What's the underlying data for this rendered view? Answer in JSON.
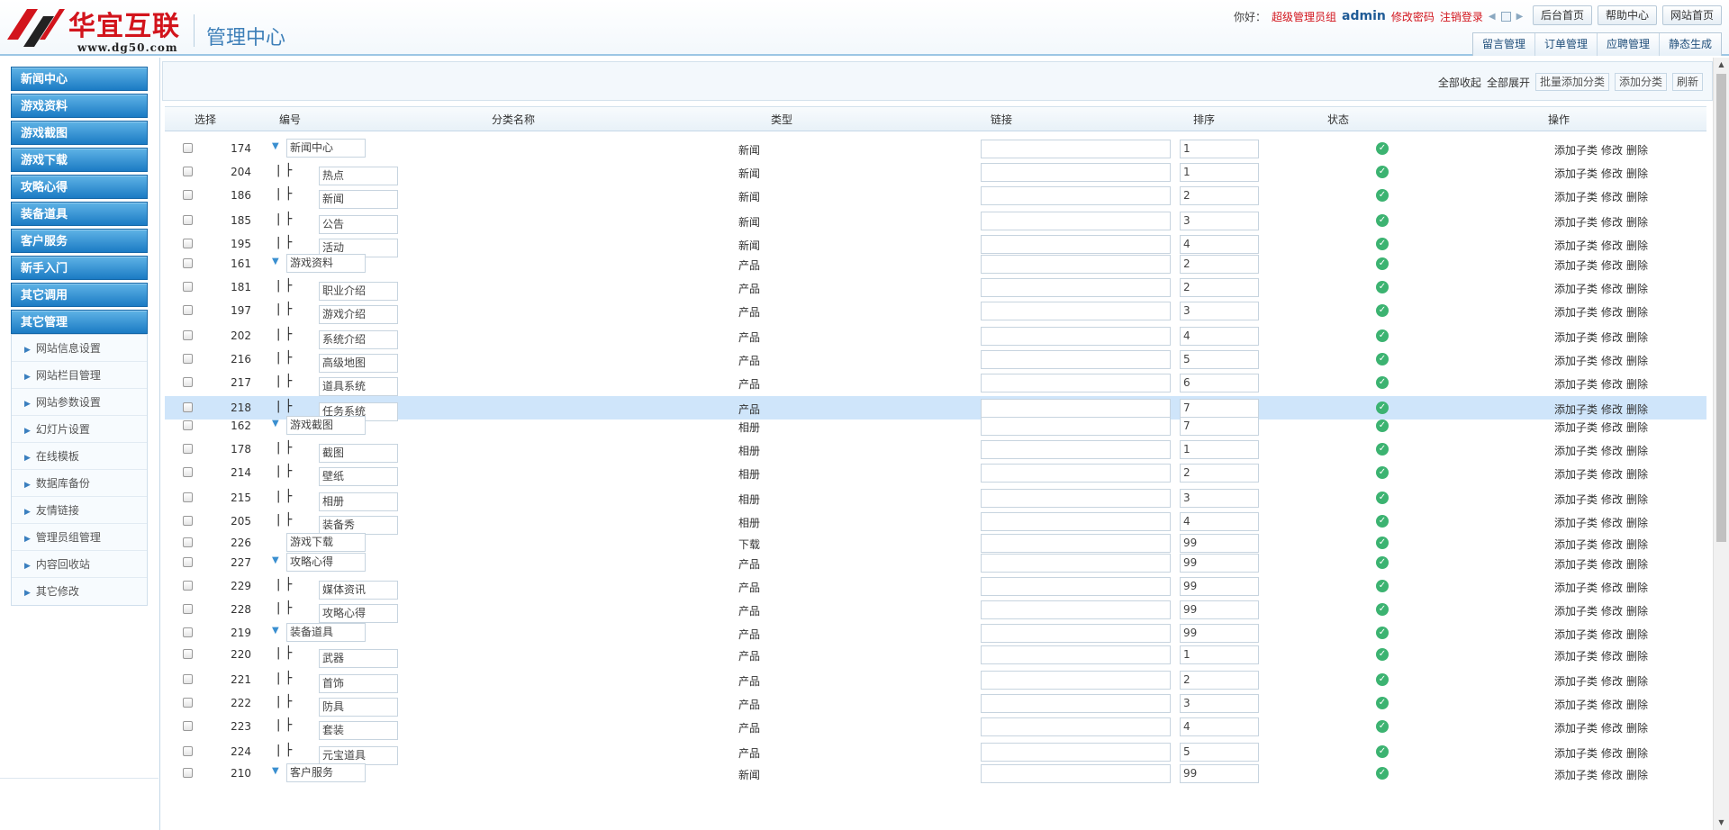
{
  "header": {
    "logo_cn": "华宜互联",
    "logo_url": "www.dg50.com",
    "title": "管理中心",
    "greeting": "你好：",
    "role": "超级管理员组",
    "username": "admin",
    "change_password": "修改密码",
    "logout": "注销登录",
    "top_buttons": [
      "后台首页",
      "帮助中心",
      "网站首页"
    ],
    "nav_tabs": [
      "留言管理",
      "订单管理",
      "应聘管理",
      "静态生成"
    ]
  },
  "sidebar": {
    "categories": [
      "新闻中心",
      "游戏资料",
      "游戏截图",
      "游戏下载",
      "攻略心得",
      "装备道具",
      "客户服务",
      "新手入门",
      "其它调用",
      "其它管理"
    ],
    "subitems": [
      "网站信息设置",
      "网站栏目管理",
      "网站参数设置",
      "幻灯片设置",
      "在线模板",
      "数据库备份",
      "友情链接",
      "管理员组管理",
      "内容回收站",
      "其它修改"
    ]
  },
  "toolbar": {
    "collapse_all": "全部收起",
    "expand_all": "全部展开",
    "batch_add": "批量添加分类",
    "add_category": "添加分类",
    "refresh": "刷新"
  },
  "table": {
    "headers": {
      "select": "选择",
      "id": "编号",
      "name": "分类名称",
      "type": "类型",
      "link": "链接",
      "sort": "排序",
      "status": "状态",
      "ops": "操作"
    },
    "ops_labels": [
      "添加子类",
      "修改",
      "删除"
    ],
    "rows": [
      {
        "id": "174",
        "level": 0,
        "toggle": true,
        "name": "新闻中心",
        "type": "新闻",
        "sort": "1"
      },
      {
        "id": "204",
        "level": 1,
        "name": "热点",
        "type": "新闻",
        "sort": "1"
      },
      {
        "id": "186",
        "level": 1,
        "name": "新闻",
        "type": "新闻",
        "sort": "2"
      },
      {
        "id": "185",
        "level": 1,
        "name": "公告",
        "type": "新闻",
        "sort": "3"
      },
      {
        "id": "195",
        "level": 1,
        "name": "活动",
        "type": "新闻",
        "sort": "4"
      },
      {
        "id": "161",
        "level": 0,
        "toggle": true,
        "name": "游戏资料",
        "type": "产品",
        "sort": "2"
      },
      {
        "id": "181",
        "level": 1,
        "name": "职业介绍",
        "type": "产品",
        "sort": "2"
      },
      {
        "id": "197",
        "level": 1,
        "name": "游戏介绍",
        "type": "产品",
        "sort": "3"
      },
      {
        "id": "202",
        "level": 1,
        "name": "系统介绍",
        "type": "产品",
        "sort": "4"
      },
      {
        "id": "216",
        "level": 1,
        "name": "高级地图",
        "type": "产品",
        "sort": "5"
      },
      {
        "id": "217",
        "level": 1,
        "name": "道具系统",
        "type": "产品",
        "sort": "6"
      },
      {
        "id": "218",
        "level": 1,
        "name": "任务系统",
        "type": "产品",
        "sort": "7",
        "selected": true
      },
      {
        "id": "162",
        "level": 0,
        "toggle": true,
        "name": "游戏截图",
        "type": "相册",
        "sort": "7"
      },
      {
        "id": "178",
        "level": 1,
        "name": "截图",
        "type": "相册",
        "sort": "1"
      },
      {
        "id": "214",
        "level": 1,
        "name": "壁纸",
        "type": "相册",
        "sort": "2"
      },
      {
        "id": "215",
        "level": 1,
        "name": "相册",
        "type": "相册",
        "sort": "3"
      },
      {
        "id": "205",
        "level": 1,
        "name": "装备秀",
        "type": "相册",
        "sort": "4"
      },
      {
        "id": "226",
        "level": 0,
        "toggle": false,
        "name": "游戏下载",
        "type": "下载",
        "sort": "99"
      },
      {
        "id": "227",
        "level": 0,
        "toggle": true,
        "name": "攻略心得",
        "type": "产品",
        "sort": "99"
      },
      {
        "id": "229",
        "level": 1,
        "name": "媒体资讯",
        "type": "产品",
        "sort": "99"
      },
      {
        "id": "228",
        "level": 1,
        "name": "攻略心得",
        "type": "产品",
        "sort": "99"
      },
      {
        "id": "219",
        "level": 0,
        "toggle": true,
        "name": "装备道具",
        "type": "产品",
        "sort": "99"
      },
      {
        "id": "220",
        "level": 1,
        "name": "武器",
        "type": "产品",
        "sort": "1"
      },
      {
        "id": "221",
        "level": 1,
        "name": "首饰",
        "type": "产品",
        "sort": "2"
      },
      {
        "id": "222",
        "level": 1,
        "name": "防具",
        "type": "产品",
        "sort": "3"
      },
      {
        "id": "223",
        "level": 1,
        "name": "套装",
        "type": "产品",
        "sort": "4"
      },
      {
        "id": "224",
        "level": 1,
        "name": "元宝道具",
        "type": "产品",
        "sort": "5"
      },
      {
        "id": "210",
        "level": 0,
        "toggle": true,
        "name": "客户服务",
        "type": "新闻",
        "sort": "99"
      }
    ]
  },
  "colors": {
    "accent": "#1b7bc4",
    "brand_red": "#d2141c",
    "selected_row": "#cfe5fa",
    "status_ok": "#3cb371"
  },
  "icons": {
    "status": "check-circle-icon",
    "toggle": "chevron-down-icon",
    "sidebar_sub": "chevron-right-icon"
  }
}
